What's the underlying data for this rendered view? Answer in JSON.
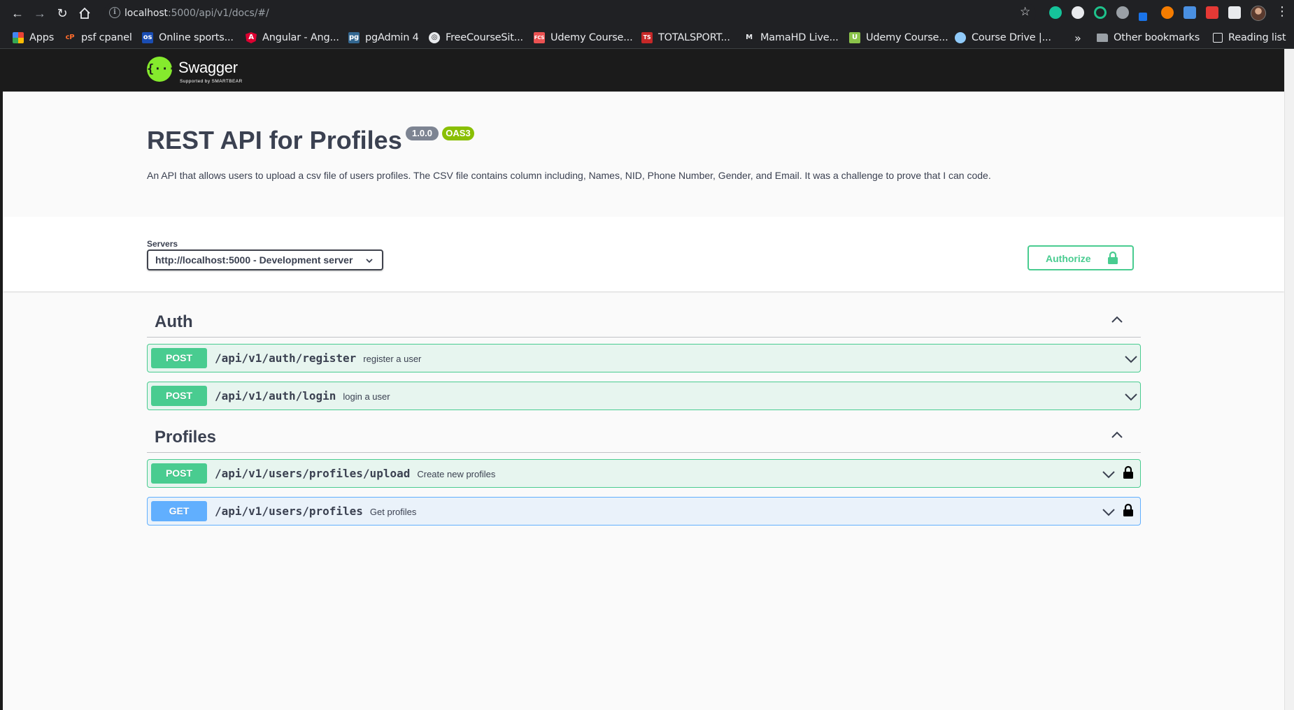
{
  "browser": {
    "url_host": "localhost",
    "url_rest": ":5000/api/v1/docs/#/",
    "bookmarks": [
      {
        "label": "Apps",
        "icon": "apps-grid-icon",
        "color": "#ea4335"
      },
      {
        "label": "psf cpanel",
        "icon": "cpanel-icon",
        "color": "#ff6c2c"
      },
      {
        "label": "Online sports...",
        "icon": "sports-icon",
        "color": "#1a4db3"
      },
      {
        "label": "Angular - Ang...",
        "icon": "angular-icon",
        "color": "#dd0031"
      },
      {
        "label": "pgAdmin 4",
        "icon": "pgadmin-icon",
        "color": "#336791"
      },
      {
        "label": "FreeCourseSit...",
        "icon": "globe-icon",
        "color": "#e8eaed"
      },
      {
        "label": "Udemy Course...",
        "icon": "udemy-icon",
        "color": "#ec5252"
      },
      {
        "label": "TOTALSPORT...",
        "icon": "totalsport-icon",
        "color": "#c62828"
      },
      {
        "label": "MamaHD Live...",
        "icon": "mamahd-icon",
        "color": "#e8eaed"
      },
      {
        "label": "Udemy Course...",
        "icon": "udemy-u-icon",
        "color": "#8bc34a"
      },
      {
        "label": "Course Drive |...",
        "icon": "coursedrive-icon",
        "color": "#90caf9"
      }
    ],
    "overflow_label": "»",
    "other_bookmarks": "Other bookmarks",
    "reading_list": "Reading list"
  },
  "swagger": {
    "logo_text": "Swagger",
    "logo_sub": "Supported by SMARTBEAR",
    "logo_glyph": "{···}"
  },
  "info": {
    "title": "REST API for Profiles",
    "version": "1.0.0",
    "oas": "OAS3",
    "description": "An API that allows users to upload a csv file of users profiles. The CSV file contains column including, Names, NID, Phone Number, Gender, and Email. It was a challenge to prove that I can code."
  },
  "servers": {
    "label": "Servers",
    "selected": "http://localhost:5000 - Development server"
  },
  "authorize_label": "Authorize",
  "colors": {
    "post": "#49cc90",
    "get": "#61affe",
    "topbar": "#1b1b1b",
    "logo": "#85ea2d"
  },
  "tags": [
    {
      "name": "Auth",
      "operations": [
        {
          "method": "POST",
          "path": "/api/v1/auth/register",
          "summary": "register a user",
          "locked": false
        },
        {
          "method": "POST",
          "path": "/api/v1/auth/login",
          "summary": "login a user",
          "locked": false
        }
      ]
    },
    {
      "name": "Profiles",
      "operations": [
        {
          "method": "POST",
          "path": "/api/v1/users/profiles/upload",
          "summary": "Create new profiles",
          "locked": true
        },
        {
          "method": "GET",
          "path": "/api/v1/users/profiles",
          "summary": "Get profiles",
          "locked": true
        }
      ]
    }
  ]
}
